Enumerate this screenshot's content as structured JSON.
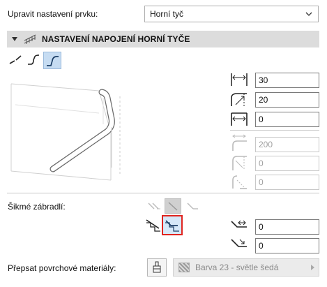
{
  "top": {
    "edit_label": "Upravit nastavení prvku:",
    "edit_value": "Horní tyč"
  },
  "section": {
    "title": "NASTAVENÍ NAPOJENÍ HORNÍ TYČE"
  },
  "connection_types": [
    "straight",
    "curved",
    "stepped"
  ],
  "selected_connection": "stepped",
  "fields": {
    "width": "30",
    "height": "20",
    "offset": "0",
    "radius": "200",
    "radius_offset": "0",
    "radius_angle": "0"
  },
  "inclined": {
    "label": "Šikmé zábradlí:",
    "field1": "0",
    "field2": "0"
  },
  "material": {
    "label": "Přepsat povrchové materiály:",
    "value": "Barva 23 - světle šedá"
  },
  "colors": {
    "accent": "#c6dcf2",
    "highlight": "#e0241f",
    "header_bg": "#dcdcdc"
  }
}
